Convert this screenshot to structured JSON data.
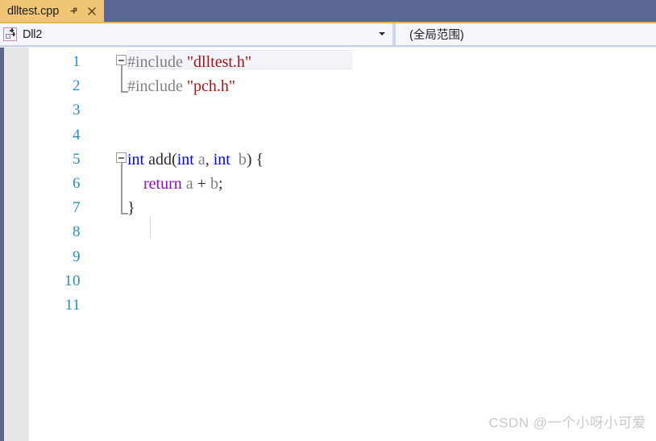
{
  "tab": {
    "title": "dlltest.cpp",
    "pin_icon": "pin-icon",
    "close_icon": "close-icon"
  },
  "navbar": {
    "project_icon": "cpp-file-icon",
    "project_label": "Dll2",
    "dropdown_icon": "chevron-down-icon",
    "scope_label": "(全局范围)"
  },
  "editor": {
    "line_numbers": [
      "1",
      "2",
      "3",
      "4",
      "5",
      "6",
      "7",
      "8",
      "9",
      "10",
      "11"
    ],
    "lines": [
      {
        "number": "1",
        "indent": 0,
        "tokens": [
          {
            "text": "#include",
            "type": "preprocessor"
          },
          {
            "text": " ",
            "type": "plain"
          },
          {
            "text": "\"dlltest.h\"",
            "type": "string"
          }
        ]
      },
      {
        "number": "2",
        "indent": 0,
        "tokens": [
          {
            "text": "#include",
            "type": "preprocessor"
          },
          {
            "text": " ",
            "type": "plain"
          },
          {
            "text": "\"pch.h\"",
            "type": "string"
          }
        ]
      },
      {
        "number": "3",
        "indent": 0,
        "tokens": []
      },
      {
        "number": "4",
        "indent": 0,
        "tokens": []
      },
      {
        "number": "5",
        "indent": 0,
        "tokens": [
          {
            "text": "int",
            "type": "keyword"
          },
          {
            "text": " ",
            "type": "plain"
          },
          {
            "text": "add",
            "type": "function"
          },
          {
            "text": "(",
            "type": "punct"
          },
          {
            "text": "int",
            "type": "keyword"
          },
          {
            "text": " ",
            "type": "plain"
          },
          {
            "text": "a",
            "type": "variable"
          },
          {
            "text": ", ",
            "type": "punct"
          },
          {
            "text": "int",
            "type": "keyword"
          },
          {
            "text": "  ",
            "type": "plain"
          },
          {
            "text": "b",
            "type": "variable"
          },
          {
            "text": ") {",
            "type": "punct"
          }
        ]
      },
      {
        "number": "6",
        "indent": 4,
        "tokens": [
          {
            "text": "    ",
            "type": "plain"
          },
          {
            "text": "return",
            "type": "control"
          },
          {
            "text": " ",
            "type": "plain"
          },
          {
            "text": "a",
            "type": "variable"
          },
          {
            "text": " ",
            "type": "plain"
          },
          {
            "text": "+",
            "type": "operator"
          },
          {
            "text": " ",
            "type": "plain"
          },
          {
            "text": "b",
            "type": "variable"
          },
          {
            "text": ";",
            "type": "punct"
          }
        ]
      },
      {
        "number": "7",
        "indent": 0,
        "tokens": [
          {
            "text": "}",
            "type": "punct"
          }
        ]
      },
      {
        "number": "8",
        "indent": 0,
        "tokens": []
      },
      {
        "number": "9",
        "indent": 0,
        "tokens": []
      },
      {
        "number": "10",
        "indent": 0,
        "tokens": []
      },
      {
        "number": "11",
        "indent": 0,
        "tokens": []
      }
    ],
    "fold_regions": [
      {
        "at_line": 1,
        "expanded": true,
        "spans_to_line": 2
      },
      {
        "at_line": 5,
        "expanded": true,
        "spans_to_line": 7
      }
    ],
    "current_line": 1
  },
  "watermark": {
    "text": "CSDN @一个小呀小可爱"
  },
  "colors": {
    "tabstrip_bg": "#5a6795",
    "tab_active_bg": "#f0c674",
    "navbar_bg": "#f5f6fb",
    "editor_bg": "#ffffff",
    "indicator_margin": "#e6e7e9",
    "edge_strip": "#5b678f",
    "line_number": "#2e8cb5",
    "preprocessor": "#808080",
    "string": "#a31515",
    "keyword": "#0000ff",
    "control_keyword": "#8f08c4",
    "variable": "#808080",
    "plain_text": "#1f1f1f"
  }
}
